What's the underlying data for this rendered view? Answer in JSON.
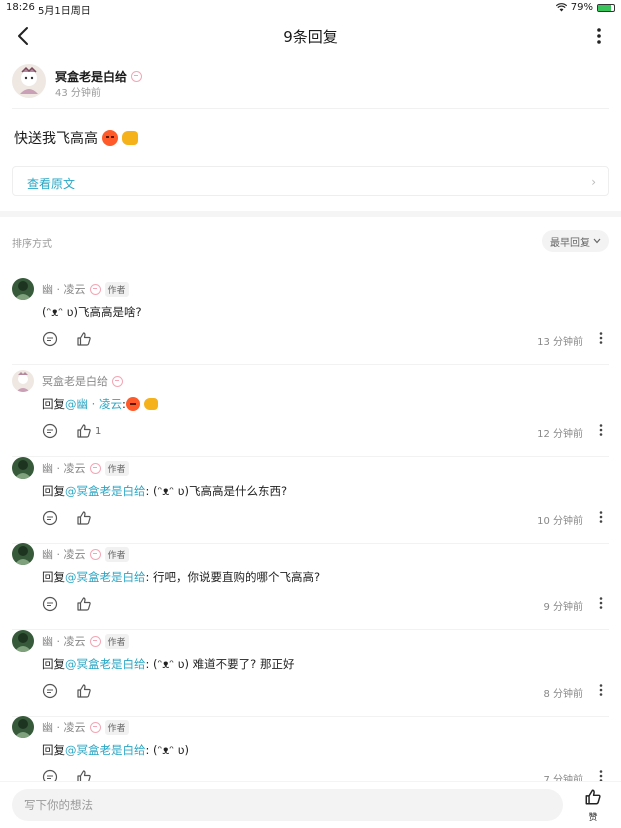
{
  "status_bar": {
    "time": "18:26",
    "date": "5月1日周日",
    "battery": "79%",
    "battery_level": 0.79
  },
  "nav": {
    "title": "9条回复"
  },
  "post": {
    "author": "冥盒老是白给",
    "time": "43 分钟前",
    "content": "快送我飞高高",
    "view_original": "查看原文"
  },
  "sort": {
    "label": "排序方式",
    "selected": "最早回复"
  },
  "replies": [
    {
      "author": "幽 · 凌云",
      "author_tag": "作者",
      "avatar": "dark",
      "prefix": "",
      "mention": "",
      "text": "(ᵔᴥᵔ ʋ)飞高高是啥?",
      "like_count": "",
      "time": "13 分钟前"
    },
    {
      "author": "冥盒老是白给",
      "author_tag": "",
      "avatar": "light",
      "prefix": "回复",
      "mention": "@幽 · 凌云",
      "text": ": ",
      "like_count": "1",
      "time": "12 分钟前"
    },
    {
      "author": "幽 · 凌云",
      "author_tag": "作者",
      "avatar": "dark",
      "prefix": "回复",
      "mention": "@冥盒老是白给",
      "text": ": (ᵔᴥᵔ ʋ)飞高高是什么东西?",
      "like_count": "",
      "time": "10 分钟前"
    },
    {
      "author": "幽 · 凌云",
      "author_tag": "作者",
      "avatar": "dark",
      "prefix": "回复",
      "mention": "@冥盒老是白给",
      "text": ": 行吧，你说要直购的哪个飞高高?",
      "like_count": "",
      "time": "9 分钟前"
    },
    {
      "author": "幽 · 凌云",
      "author_tag": "作者",
      "avatar": "dark",
      "prefix": "回复",
      "mention": "@冥盒老是白给",
      "text": ": (ᵔᴥᵔ ʋ) 难道不要了? 那正好",
      "like_count": "",
      "time": "8 分钟前"
    },
    {
      "author": "幽 · 凌云",
      "author_tag": "作者",
      "avatar": "dark",
      "prefix": "回复",
      "mention": "@冥盒老是白给",
      "text": ": (ᵔᴥᵔ ʋ)",
      "like_count": "",
      "time": "7 分钟前"
    }
  ],
  "bottom": {
    "placeholder": "写下你的想法",
    "like_label": "赞"
  },
  "colors": {
    "accent": "#2aa6c4",
    "battery": "#3ac35a"
  }
}
